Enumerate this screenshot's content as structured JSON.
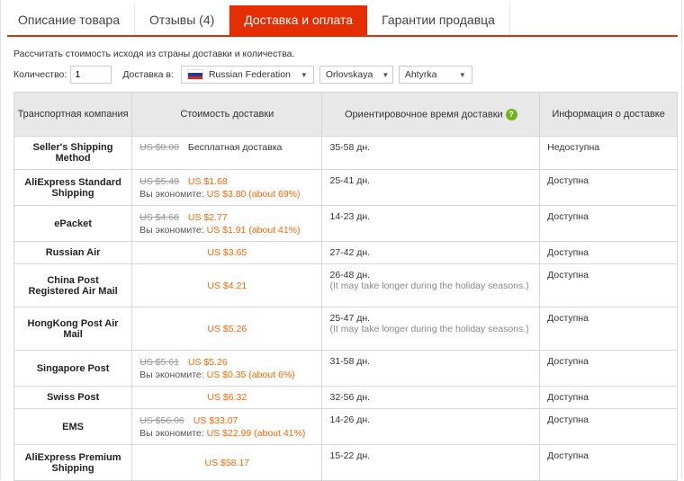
{
  "tabs": [
    {
      "label": "Описание товара",
      "active": false
    },
    {
      "label": "Отзывы (4)",
      "active": false
    },
    {
      "label": "Доставка и оплата",
      "active": true
    },
    {
      "label": "Гарантии продавца",
      "active": false
    }
  ],
  "hint": "Рассчитать стоимость исходя из страны доставки и количества.",
  "controls": {
    "quantity_label": "Количество:",
    "quantity_value": "1",
    "delivery_label": "Доставка в:",
    "country": "Russian Federation",
    "region": "Orlovskaya",
    "city": "Ahtyrka"
  },
  "table": {
    "headers": {
      "company": "Транспортная компания",
      "cost": "Стоимость доставки",
      "time": "Ориентировочное время доставки",
      "info": "Информация о доставке"
    },
    "save_label": "Вы экономите:",
    "rows": [
      {
        "company": "Seller's Shipping Method",
        "old": "US $0.00",
        "price": "Бесплатная доставка",
        "saving": "",
        "time": "35-58 дн.",
        "note": "",
        "info": "Недоступна"
      },
      {
        "company": "AliExpress Standard Shipping",
        "old": "US $5.48",
        "price": "US $1.68",
        "saving": "US $3.80 (about 69%)",
        "time": "25-41 дн.",
        "note": "",
        "info": "Доступна"
      },
      {
        "company": "ePacket",
        "old": "US $4.68",
        "price": "US $2.77",
        "saving": "US $1.91 (about 41%)",
        "time": "14-23 дн.",
        "note": "",
        "info": "Доступна"
      },
      {
        "company": "Russian Air",
        "old": "",
        "price": "US $3.65",
        "saving": "",
        "time": "27-42 дн.",
        "note": "",
        "info": "Доступна"
      },
      {
        "company": "China Post Registered Air Mail",
        "old": "",
        "price": "US $4.21",
        "saving": "",
        "time": "26-48 дн.",
        "note": "(It may take longer during the holiday seasons.)",
        "info": "Доступна"
      },
      {
        "company": "HongKong Post Air Mail",
        "old": "",
        "price": "US $5.26",
        "saving": "",
        "time": "25-47 дн.",
        "note": "(It may take longer during the holiday seasons.)",
        "info": "Доступна"
      },
      {
        "company": "Singapore Post",
        "old": "US $5.61",
        "price": "US $5.26",
        "saving": "US $0.35 (about 6%)",
        "time": "31-58 дн.",
        "note": "",
        "info": "Доступна"
      },
      {
        "company": "Swiss Post",
        "old": "",
        "price": "US $6.32",
        "saving": "",
        "time": "32-56 дн.",
        "note": "",
        "info": "Доступна"
      },
      {
        "company": "EMS",
        "old": "US $56.06",
        "price": "US $33.07",
        "saving": "US $22.99 (about 41%)",
        "time": "14-26 дн.",
        "note": "",
        "info": "Доступна"
      },
      {
        "company": "AliExpress Premium Shipping",
        "old": "",
        "price": "US $58.17",
        "saving": "",
        "time": "15-22 дн.",
        "note": "",
        "info": "Доступна"
      }
    ]
  },
  "colors": {
    "accent": "#e62e04",
    "price": "#ff6600",
    "help": "#73b21d"
  }
}
